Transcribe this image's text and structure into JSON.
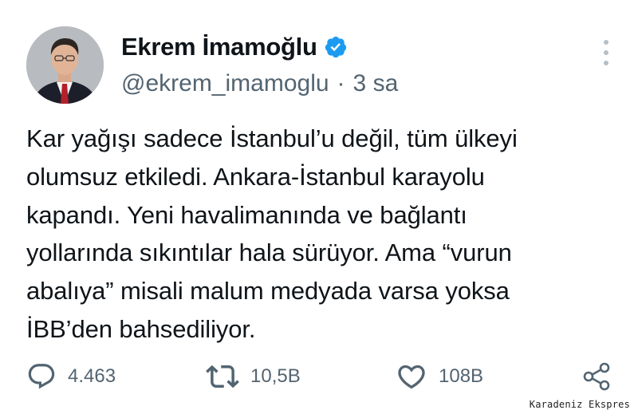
{
  "author": {
    "display_name": "Ekrem İmamoğlu",
    "handle": "@ekrem_imamoglu",
    "separator": "·",
    "time": "3 sa",
    "verified": true
  },
  "tweet": {
    "lines": [
      "Kar yağışı sadece İstanbul’u değil, tüm ülkeyi",
      "olumsuz etkiledi. Ankara-İstanbul karayolu",
      "kapandı. Yeni havalimanında ve bağlantı",
      "yollarında sıkıntılar hala sürüyor. Ama “vurun",
      "abalıya” misali malum medyada varsa yoksa",
      "İBB’den bahsediliyor."
    ]
  },
  "actions": {
    "replies": "4.463",
    "retweets": "10,5B",
    "likes": "108B"
  },
  "watermark": "Karadeniz Ekspres",
  "colors": {
    "text": "#0f1419",
    "secondary": "#536471",
    "verified": "#1d9bf0"
  },
  "icons": [
    "reply-icon",
    "retweet-icon",
    "like-icon",
    "share-icon",
    "verified-badge-icon",
    "more-options-icon"
  ]
}
